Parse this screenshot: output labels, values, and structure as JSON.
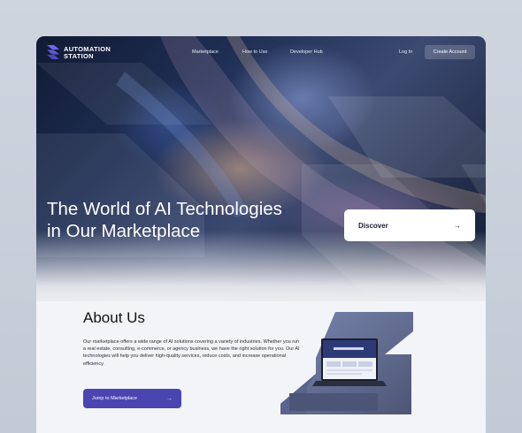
{
  "brand": {
    "line1": "AUTOMATION",
    "line2": "STATION",
    "logo_icon": "stacked-chevrons-logo-icon"
  },
  "nav": {
    "links": [
      "Marketplace",
      "How to Use",
      "Developer Hub"
    ],
    "login": "Log In",
    "create_account": "Create Account"
  },
  "hero": {
    "title_line1": "The World of AI Technologies",
    "title_line2": "in Our Marketplace",
    "discover_label": "Discover",
    "discover_icon": "arrow-right-icon"
  },
  "about": {
    "title": "About Us",
    "body": "Our marketplace offers a wide range of AI solutions covering a variety of industries. Whether you run a real estate, consulting, e-commerce, or agency business, we have the right solution for you. Our AI technologies will help you deliver high-quality services, reduce costs, and increase operational efficiency.",
    "cta_label": "Jump to Marketplace",
    "cta_icon": "arrow-right-icon"
  },
  "colors": {
    "accent": "#4a45b0",
    "background": "#f3f4f7",
    "logo": "#5b5bd6"
  }
}
